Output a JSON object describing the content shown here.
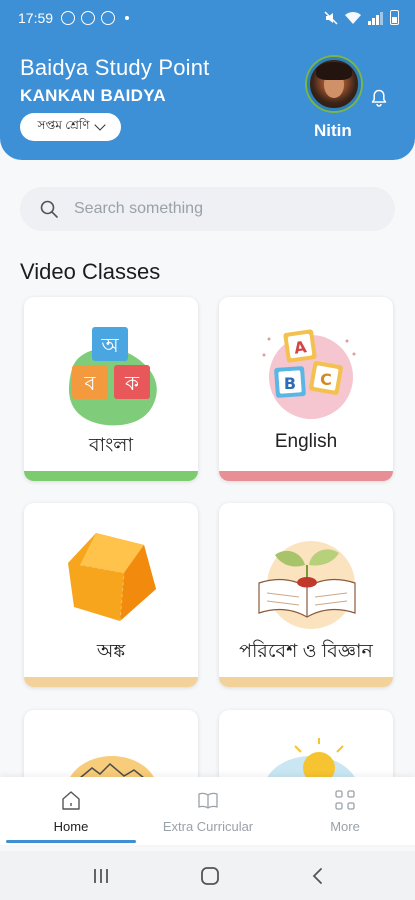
{
  "status": {
    "time": "17:59"
  },
  "header": {
    "title": "Baidya Study Point",
    "subtitle": "KANKAN BAIDYA",
    "class_selector": "সপ্তম শ্রেণি",
    "user_name": "Nitin"
  },
  "search": {
    "placeholder": "Search something"
  },
  "section": {
    "title": "Video Classes"
  },
  "subjects": [
    {
      "label": "বাংলা",
      "accent": "#7ccb6e"
    },
    {
      "label": "English",
      "accent": "#e88f95"
    },
    {
      "label": "অঙ্ক",
      "accent": "#f2d29a"
    },
    {
      "label": "পরিবেশ ও বিজ্ঞান",
      "accent": "#f2d29a"
    }
  ],
  "nav": {
    "home": "Home",
    "extra": "Extra Curricular",
    "more": "More"
  },
  "colors": {
    "primary": "#3d8fd6"
  }
}
